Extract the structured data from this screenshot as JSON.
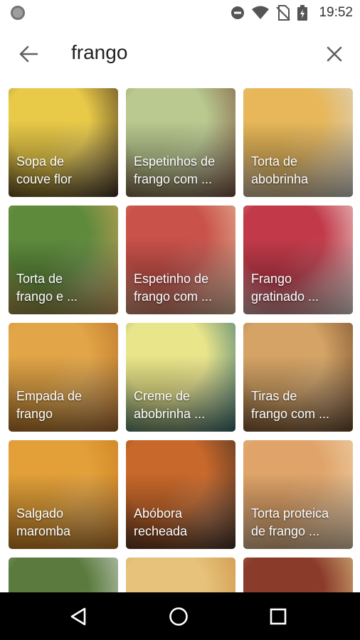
{
  "status_bar": {
    "time": "19:52",
    "icons": [
      "notification-dot-icon",
      "do-not-disturb-icon",
      "wifi-icon",
      "no-sim-icon",
      "battery-charging-icon"
    ]
  },
  "search": {
    "query": "frango",
    "back_icon": "arrow-left-icon",
    "clear_icon": "close-icon"
  },
  "recipes": [
    {
      "line1": "Sopa de",
      "line2": "couve flor",
      "colors": [
        "#e8c948",
        "#3b2a1d"
      ]
    },
    {
      "line1": "Espetinhos de",
      "line2": "frango com ...",
      "colors": [
        "#b9c98f",
        "#7a4e3a"
      ]
    },
    {
      "line1": "Torta de",
      "line2": "abobrinha",
      "colors": [
        "#e7b75a",
        "#d9d9d9"
      ]
    },
    {
      "line1": "Torta de",
      "line2": "frango e ...",
      "colors": [
        "#5e8a3c",
        "#d9a55b"
      ]
    },
    {
      "line1": "Espetinho de",
      "line2": "frango com ...",
      "colors": [
        "#c9524a",
        "#e7c59f"
      ]
    },
    {
      "line1": "Frango",
      "line2": "gratinado ...",
      "colors": [
        "#c23a4a",
        "#f2ece4"
      ]
    },
    {
      "line1": "Empada de",
      "line2": "frango",
      "colors": [
        "#e2a547",
        "#b36a24"
      ]
    },
    {
      "line1": "Creme de",
      "line2": "abobrinha ...",
      "colors": [
        "#e9e58a",
        "#2c6b6f"
      ]
    },
    {
      "line1": "Tiras de",
      "line2": "frango com ...",
      "colors": [
        "#d4a365",
        "#6a4426"
      ]
    },
    {
      "line1": "Salgado",
      "line2": "maromba",
      "colors": [
        "#e3a039",
        "#c97a1f"
      ]
    },
    {
      "line1": "Abóbora",
      "line2": "recheada",
      "colors": [
        "#c8682b",
        "#3d2c22"
      ]
    },
    {
      "line1": "Torta proteica",
      "line2": "de frango ...",
      "colors": [
        "#e0a46a",
        "#f1d9b6"
      ]
    },
    {
      "line1": "",
      "line2": "",
      "colors": [
        "#5a7b3d",
        "#dcdcdc"
      ]
    },
    {
      "line1": "",
      "line2": "",
      "colors": [
        "#e7c27a",
        "#c78a3d"
      ]
    },
    {
      "line1": "",
      "line2": "",
      "colors": [
        "#8a3b2a",
        "#e9d28f"
      ]
    }
  ],
  "nav_bar": {
    "back_icon": "triangle-back-icon",
    "home_icon": "circle-home-icon",
    "recents_icon": "square-recents-icon"
  }
}
